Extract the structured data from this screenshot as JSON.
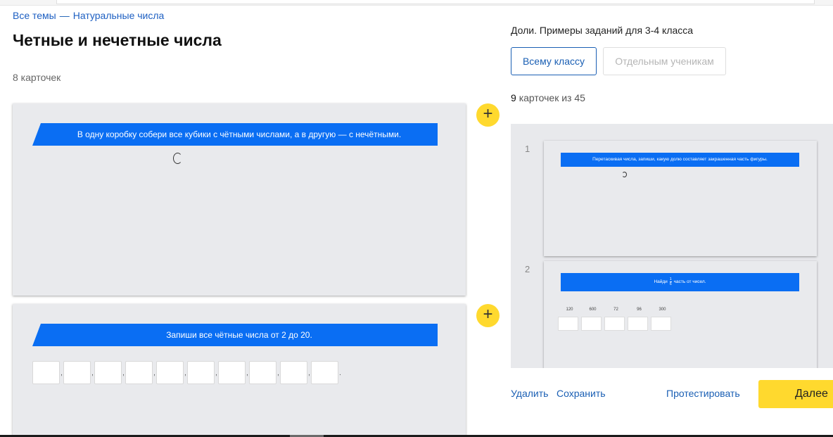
{
  "breadcrumb": {
    "root": "Все темы",
    "separator": "—",
    "current": "Натуральные числа"
  },
  "page": {
    "title": "Четные и нечетные числа",
    "card_count": "8 карточек"
  },
  "cards": [
    {
      "banner": "В одну коробку собери все кубики с чётными числами, а в другую — с нечётными."
    },
    {
      "banner": "Запиши все чётные числа от 2 до 20.",
      "answer_boxes": 10,
      "comma": ",",
      "end": "."
    }
  ],
  "add_button_label": "+",
  "sample": {
    "title": "Доли. Примеры заданий для 3-4 класса",
    "tabs": {
      "all_class": "Всему классу",
      "individual": "Отдельным ученикам"
    },
    "selected_num": "9",
    "selected_rest": "карточек из 45"
  },
  "preview": {
    "cards": [
      {
        "num": "1",
        "banner": "Перетаскивая числа, запиши, какую долю составляет закрашенная часть фигуры."
      },
      {
        "num": "2",
        "banner_prefix": "Найди",
        "frac_num": "1",
        "frac_den": "6",
        "banner_suffix": "часть от чисел.",
        "numbers": [
          "120",
          "600",
          "72",
          "96",
          "300"
        ]
      }
    ]
  },
  "actions": {
    "delete": "Удалить",
    "save": "Сохранить",
    "test": "Протестировать",
    "next": "Далее"
  },
  "colors": {
    "accent_blue": "#0a6ef3",
    "link_blue": "#1a5fb4",
    "yellow": "#ffd92e",
    "card_bg": "#e9eaed"
  }
}
